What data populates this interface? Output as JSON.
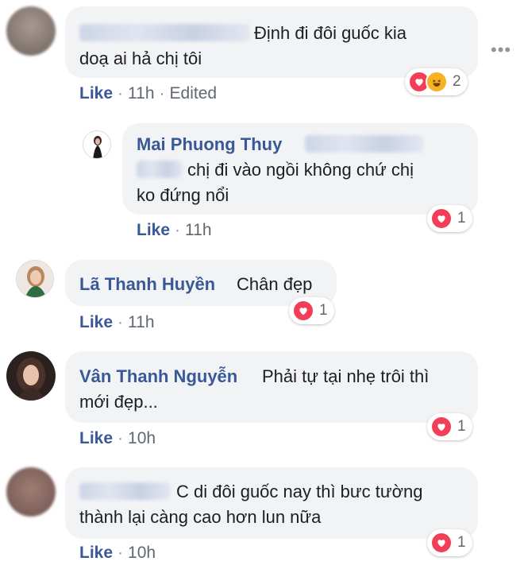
{
  "comments": [
    {
      "text_line1": "Định đi đôi guốc kia",
      "text_line2": "doạ ai hả chị tôi",
      "like_label": "Like",
      "time": "11h",
      "edited": "Edited",
      "reaction_count": "2",
      "reactions": [
        "love-icon",
        "haha-icon"
      ]
    },
    {
      "author": "Mai Phuong Thuy",
      "text_line1": "chị đi vào ngồi không chứ chị",
      "text_line2": "ko đứng nổi",
      "like_label": "Like",
      "time": "11h",
      "reaction_count": "1",
      "reactions": [
        "love-icon"
      ]
    },
    {
      "author": "Lã Thanh Huyền",
      "text_line1": "Chân đẹp",
      "like_label": "Like",
      "time": "11h",
      "reaction_count": "1",
      "reactions": [
        "love-icon"
      ]
    },
    {
      "author": "Vân Thanh Nguyễn",
      "text_line1": "Phải tự tại nhẹ trôi thì",
      "text_line2": "mới đẹp...",
      "like_label": "Like",
      "time": "10h",
      "reaction_count": "1",
      "reactions": [
        "love-icon"
      ]
    },
    {
      "text_line1": "C di đôi guốc nay thì bưc tường",
      "text_line2": "thành lại càng cao hơn lun nữa",
      "like_label": "Like",
      "time": "10h",
      "reaction_count": "1",
      "reactions": [
        "love-icon"
      ]
    }
  ],
  "separator": "·",
  "more_options": "•••",
  "colors": {
    "link": "#385898",
    "bubble": "#f2f3f5",
    "love": "#f33e58",
    "haha": "#f7b125",
    "meta": "#606770"
  }
}
